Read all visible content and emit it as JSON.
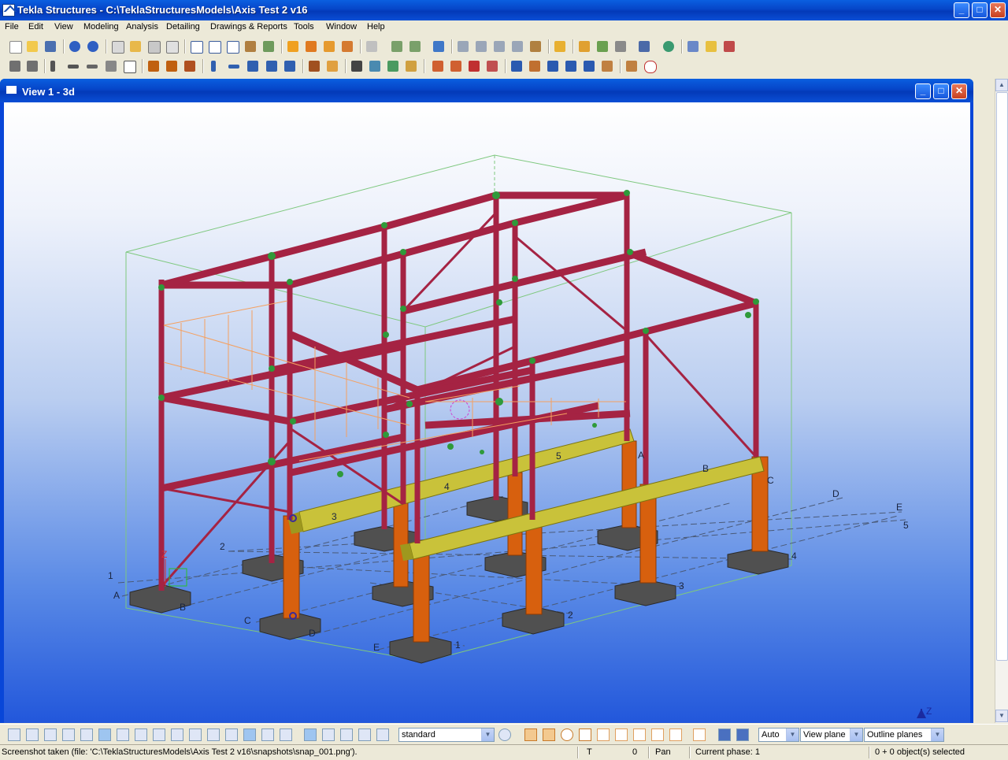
{
  "app": {
    "title": "Tekla Structures - C:\\TeklaStructuresModels\\Axis Test 2 v16",
    "min_glyph": "_",
    "max_glyph": "□",
    "close_glyph": "✕"
  },
  "menu": [
    "File",
    "Edit",
    "View",
    "Modeling",
    "Analysis",
    "Detailing",
    "Drawings & Reports",
    "Tools",
    "Window",
    "Help"
  ],
  "view": {
    "title": "View 1 - 3d",
    "axis_label": "Z"
  },
  "grid_labels": {
    "letters": [
      "A",
      "B",
      "C",
      "D",
      "E"
    ],
    "numbers": [
      "1",
      "2",
      "3",
      "4",
      "5"
    ]
  },
  "bottom_toolbar": {
    "select_filter": "standard",
    "snap_depth": "Auto",
    "snap_plane": "View plane",
    "work_plane": "Outline planes"
  },
  "status": {
    "message": "Screenshot taken (file: 'C:\\TeklaStructuresModels\\Axis Test 2 v16\\snapshots\\snap_001.png').",
    "mode_letter": "T",
    "count": "0",
    "command": "Pan",
    "phase": "Current phase: 1",
    "selection": "0 + 0 object(s) selected"
  },
  "colors": {
    "steel_maroon": "#a52343",
    "concrete_orange": "#d7600e",
    "beam_yellow": "#c9c23a",
    "footing_gray": "#505050",
    "railing_orange": "#f5a060",
    "grid_line": "#4a5a78"
  }
}
